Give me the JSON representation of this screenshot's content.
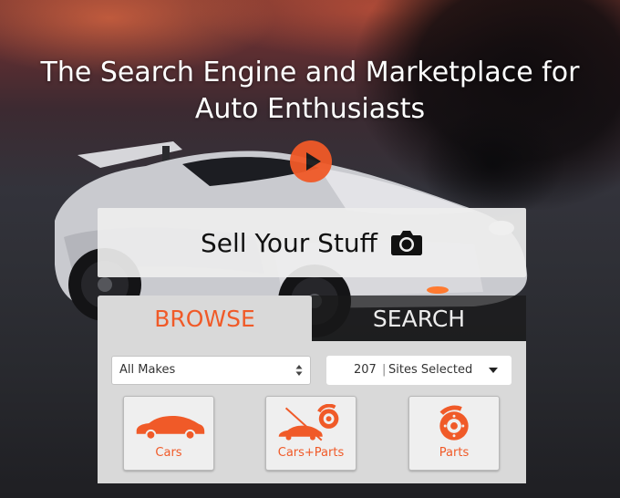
{
  "hero": {
    "headline_line1": "The Search Engine and Marketplace for",
    "headline_line2": "Auto Enthusiasts"
  },
  "sell": {
    "label": "Sell Your Stuff"
  },
  "tabs": [
    {
      "label": "BROWSE",
      "active": true
    },
    {
      "label": "SEARCH",
      "active": false
    }
  ],
  "filters": {
    "make_select_value": "All Makes",
    "sites_count": "207",
    "sites_label": "Sites Selected"
  },
  "categories": [
    {
      "label": "Cars",
      "icon": "car-icon"
    },
    {
      "label": "Cars+Parts",
      "icon": "cars-plus-parts-icon"
    },
    {
      "label": "Parts",
      "icon": "brake-disc-icon"
    }
  ],
  "colors": {
    "accent": "#f05a28",
    "panel": "#d9d9d9"
  }
}
